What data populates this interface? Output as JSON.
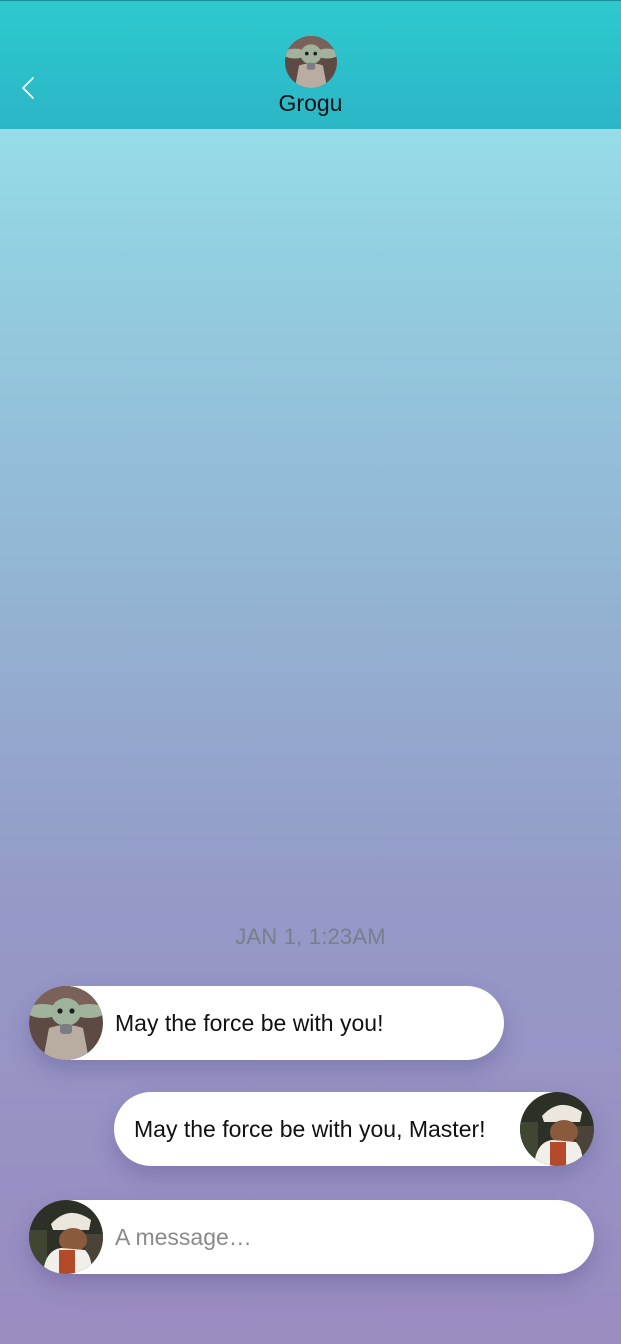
{
  "header": {
    "back_icon": "chevron-left-icon",
    "contact_name": "Grogu",
    "contact_avatar": "grogu-avatar"
  },
  "conversation": {
    "timestamp": "JAN 1, 1:23AM",
    "messages": [
      {
        "direction": "incoming",
        "sender_avatar": "grogu-avatar",
        "text": "May the force be with you!"
      },
      {
        "direction": "outgoing",
        "sender_avatar": "user-avatar",
        "text": "May the force be with you, Master!"
      }
    ]
  },
  "composer": {
    "avatar": "user-avatar",
    "value": "",
    "placeholder": "A message…"
  },
  "colors": {
    "header_top": "#2ec9cf",
    "header_bottom": "#2bb6c6",
    "background_top": "#9aecf2",
    "background_bottom": "#9a8bc1",
    "bubble": "#ffffff"
  }
}
